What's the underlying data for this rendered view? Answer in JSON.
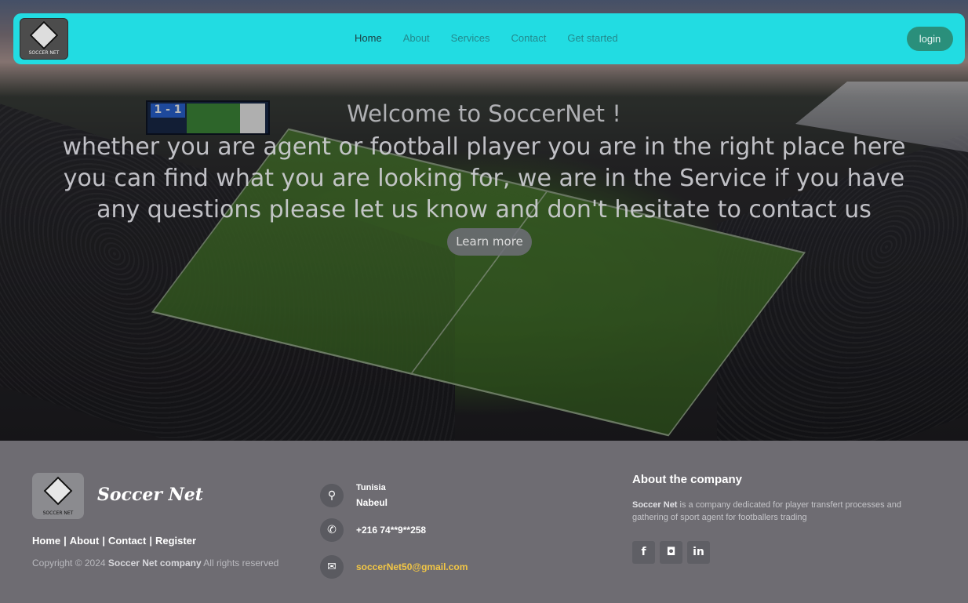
{
  "navbar": {
    "logo_text": "SOCCER NET",
    "links": [
      "Home",
      "About",
      "Services",
      "Contact",
      "Get started"
    ],
    "login_label": "login"
  },
  "hero": {
    "title": "Welcome to SoccerNet !",
    "subtitle": "whether you are agent or football player you are in the right place here you can find what you are looking for, we are in the Service if you have any questions please let us know and don't hesitate to contact us",
    "cta_label": "Learn more",
    "scoreboard_score": "1 - 1"
  },
  "footer": {
    "logo_text": "SOCCER NET",
    "brand": "Soccer Net",
    "links": [
      "Home",
      "About",
      "Contact",
      "Register"
    ],
    "copyright_prefix": "Copyright © 2024",
    "copyright_company": "Soccer Net company",
    "copyright_suffix": "All rights reserved",
    "address_line1": "Tunisia",
    "address_line2": "Nabeul",
    "phone": "+216 74**9**258",
    "email": "soccerNet50@gmail.com",
    "about_title": "About the company",
    "about_company": "Soccer Net",
    "about_text": "is a company dedicated for player transfert processes and gathering of sport agent for footballers trading",
    "socials": [
      "f",
      "◘",
      "in"
    ]
  },
  "colors": {
    "navbar_bg": "#22dce2",
    "login_bg": "#2a8f7b",
    "footer_bg": "#6e6c72",
    "email": "#f2c645"
  },
  "icons": {
    "location": "location-pin-icon",
    "phone": "phone-icon",
    "email": "envelope-icon",
    "facebook": "facebook-icon",
    "instagram": "instagram-icon",
    "linkedin": "linkedin-icon"
  }
}
